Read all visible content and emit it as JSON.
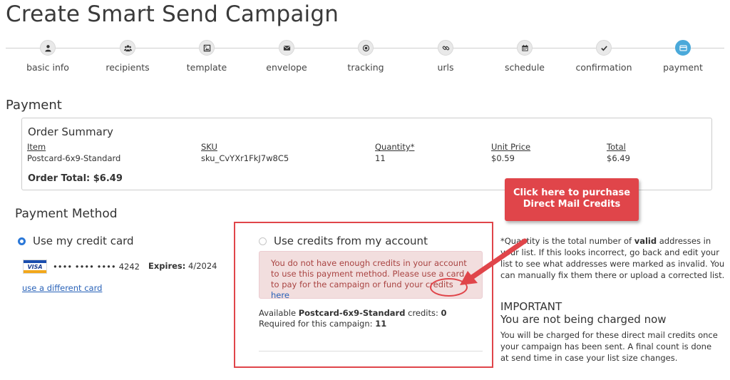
{
  "page": {
    "title": "Create Smart Send Campaign"
  },
  "steps": [
    {
      "label": "basic info",
      "icon": "user-icon",
      "active": false
    },
    {
      "label": "recipients",
      "icon": "users-icon",
      "active": false
    },
    {
      "label": "template",
      "icon": "image-icon",
      "active": false
    },
    {
      "label": "envelope",
      "icon": "envelope-icon",
      "active": false
    },
    {
      "label": "tracking",
      "icon": "dot-circle-icon",
      "active": false
    },
    {
      "label": "urls",
      "icon": "link-icon",
      "active": false
    },
    {
      "label": "schedule",
      "icon": "calendar-icon",
      "active": false
    },
    {
      "label": "confirmation",
      "icon": "check-icon",
      "active": false
    },
    {
      "label": "payment",
      "icon": "credit-card-icon",
      "active": true
    }
  ],
  "payment": {
    "section_title": "Payment",
    "order_summary": {
      "title": "Order Summary",
      "headers": {
        "item": "Item",
        "sku": "SKU",
        "quantity": "Quantity*",
        "unit_price": "Unit Price",
        "total": "Total"
      },
      "row": {
        "item": "Postcard-6x9-Standard",
        "sku": "sku_CvYXr1FkJ7w8C5",
        "quantity": "11",
        "unit_price": "$0.59",
        "total": "$6.49"
      },
      "order_total": "Order Total: $6.49"
    },
    "method": {
      "title": "Payment Method",
      "credit_card": {
        "label": "Use my credit card",
        "selected": true,
        "card_brand": "VISA",
        "masked_number": "•••• •••• ••••",
        "last4": "4242",
        "expires_label": "Expires:",
        "expires_value": "4/2024",
        "different_card_link": "use a different card"
      },
      "credits": {
        "label": "Use credits from my account",
        "selected": false,
        "alert_text": "You do not have enough credits in your account to use this payment method. Please use a card to pay for the campaign or fund your credits",
        "alert_link": "here",
        "available_prefix": "Available",
        "available_product": "Postcard-6x9-Standard",
        "available_suffix": "credits:",
        "available_count": "0",
        "required_label": "Required for this campaign:",
        "required_count": "11"
      }
    },
    "callout": {
      "line1": "Click here to purchase",
      "line2": "Direct Mail Credits"
    },
    "note": {
      "part1": "*Quantity is the total number of ",
      "bold": "valid",
      "part2": " addresses in your list. If this looks incorrect, go back and edit your list to see what addresses were marked as invalid. You can manually fix them there or upload a corrected list."
    },
    "important": {
      "title": "IMPORTANT",
      "subtitle": "You are not being charged now",
      "body": "You will be charged for these direct mail credits once your campaign has been sent. A final count is done at send time in case your list size changes."
    }
  },
  "colors": {
    "accent_red": "#e0454a",
    "active_step": "#4aa9da",
    "link_blue": "#2962b8",
    "alert_bg": "#f2dede",
    "alert_text": "#a94442"
  }
}
